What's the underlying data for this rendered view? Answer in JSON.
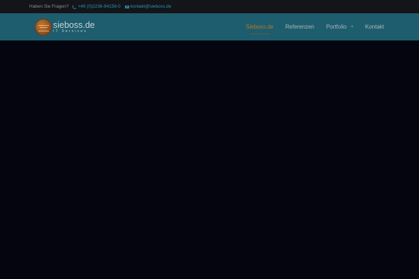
{
  "topbar": {
    "question": "Haben Sie Fragen?",
    "phone": "+49 (0)2236-94158-0",
    "email": "kontakt@sieboss.de"
  },
  "header": {
    "logo": {
      "name": "sieboss.de",
      "tagline": "IT Services"
    },
    "nav": [
      {
        "label": "Sieboss.de",
        "active": true
      },
      {
        "label": "Referenzen"
      },
      {
        "label": "Portfolio",
        "has_submenu": true
      },
      {
        "label": "Kontakt"
      }
    ]
  },
  "colors": {
    "topbar_bg": "#141519",
    "header_bg": "#1e5d6e",
    "content_bg": "#05050f",
    "accent_link": "#2f8fb8",
    "active_nav": "#b07a2a"
  }
}
